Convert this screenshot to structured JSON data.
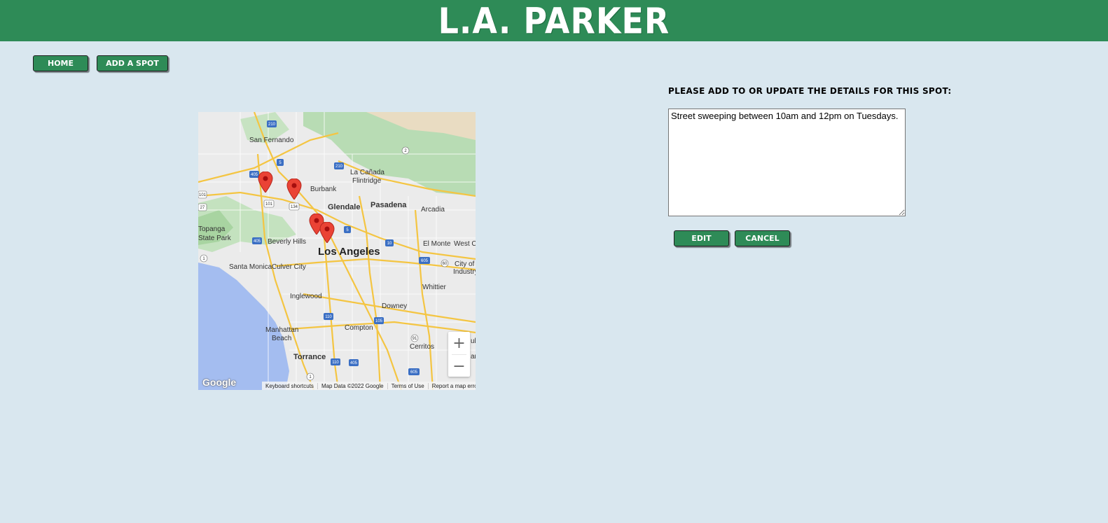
{
  "header": {
    "title": "L.A. PARKER"
  },
  "nav": {
    "home_label": "Home",
    "add_label": "Add a Spot"
  },
  "form": {
    "prompt": "Please add to or update the details for this spot:",
    "details_value": "Street sweeping between 10am and 12pm on Tuesdays.",
    "edit_label": "Edit",
    "cancel_label": "Cancel"
  },
  "map": {
    "labels": {
      "san_fernando": "San Fernando",
      "la_canada": "La Cañada",
      "flintridge": "Flintridge",
      "burbank": "Burbank",
      "glendale": "Glendale",
      "pasadena": "Pasadena",
      "arcadia": "Arcadia",
      "topanga": "Topanga",
      "state_park": "State Park",
      "beverly_hills": "Beverly Hills",
      "los_angeles": "Los Angeles",
      "el_monte": "El Monte",
      "west_c": "West C",
      "santa_monica": "Santa Monica",
      "culver_city": "Culver City",
      "city_of": "City of",
      "industry": "Industry",
      "whittier": "Whittier",
      "inglewood": "Inglewood",
      "downey": "Downey",
      "manhattan": "Manhattan",
      "beach": "Beach",
      "compton": "Compton",
      "cerritos": "Cerritos",
      "torrance": "Torrance",
      "ull": "ull",
      "an": "an"
    },
    "shields": [
      "210",
      "5",
      "2",
      "210",
      "405",
      "101",
      "134",
      "27",
      "101",
      "5",
      "405",
      "10",
      "1",
      "60",
      "605",
      "110",
      "105",
      "91",
      "405",
      "605",
      "110",
      "1"
    ],
    "zoom_in": "+",
    "zoom_out": "−",
    "google": "Google",
    "attribution": [
      "Keyboard shortcuts",
      "Map Data ©2022 Google",
      "Terms of Use",
      "Report a map error"
    ],
    "marker_icon": "map-pin-icon"
  },
  "colors": {
    "brand_green": "#2e8b57",
    "background": "#d9e7ef",
    "marker_red": "#ea4335"
  }
}
